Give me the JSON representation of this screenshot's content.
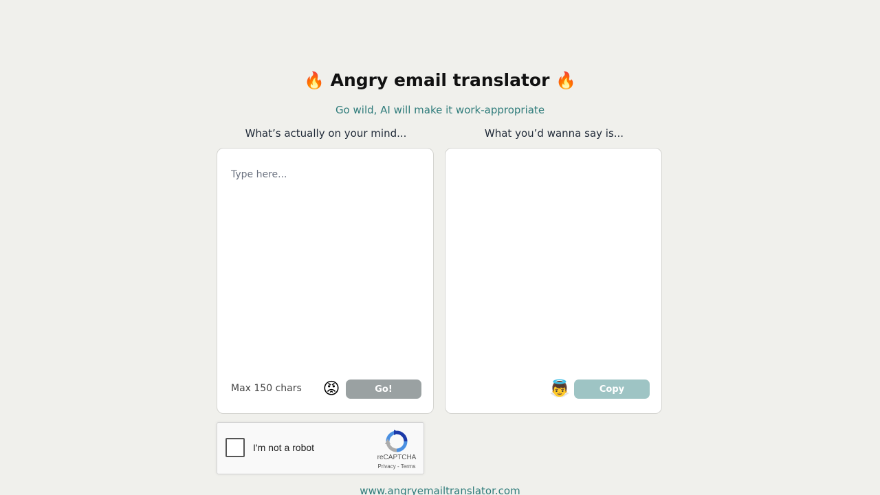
{
  "header": {
    "title_prefix_emoji": "🔥",
    "title": "Angry email translator",
    "title_suffix_emoji": "🔥",
    "subtitle": "Go wild, AI will make it work-appropriate"
  },
  "input_panel": {
    "label": "What’s actually on your mind...",
    "placeholder": "Type here...",
    "max_chars_text": "Max 150 chars",
    "face_emoji": "😡",
    "button_label": "Go!"
  },
  "output_panel": {
    "label": "What you’d wanna say is...",
    "face_emoji": "👼",
    "button_label": "Copy"
  },
  "captcha": {
    "label": "I'm not a robot",
    "brand": "reCAPTCHA",
    "privacy": "Privacy",
    "separator": " - ",
    "terms": "Terms"
  },
  "footer": {
    "link_text": "www.angryemailtranslator.com"
  },
  "colors": {
    "background": "#f0f0ec",
    "accent_teal": "#2e7b7a",
    "go_button": "#9aa1a2",
    "copy_button": "#9ec4c4"
  }
}
